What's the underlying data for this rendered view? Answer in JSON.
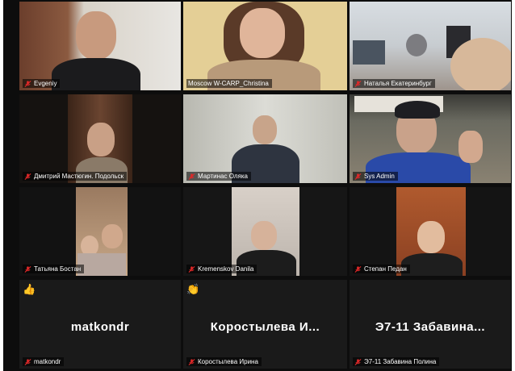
{
  "participants": [
    {
      "name": "Evgeniy",
      "muted": true
    },
    {
      "name": "Moscow W-CARP_Christina",
      "muted": true,
      "active_speaker": true
    },
    {
      "name": "Наталья Екатеринбург",
      "muted": true
    },
    {
      "name": "Дмитрий Мастюгин. Подольск",
      "muted": true
    },
    {
      "name": "Мартинас Оляка",
      "muted": true
    },
    {
      "name": "Sys Admin",
      "muted": true
    },
    {
      "name": "Татьяна Бостан",
      "muted": true
    },
    {
      "name": "Kremenskov Danila",
      "muted": true
    },
    {
      "name": "Степан Педан",
      "muted": true
    },
    {
      "name": "matkondr",
      "muted": true,
      "video_off": true,
      "display_text": "matkondr",
      "reaction": "thumbs-up"
    },
    {
      "name": "Коростылева Ирина",
      "muted": true,
      "video_off": true,
      "display_text": "Коростылева И...",
      "reaction": "clap"
    },
    {
      "name": "Э7-11 Забавина Полина",
      "muted": true,
      "video_off": true,
      "display_text": "Э7-11 Забавина..."
    }
  ],
  "colors": {
    "active_speaker_border": "#d9e23a",
    "muted_icon": "#e02828",
    "background": "#0d0d0d"
  },
  "icons": {
    "muted": "mic-muted-icon",
    "reaction_thumbs": "thumbs-up-icon",
    "reaction_clap": "clap-icon"
  }
}
